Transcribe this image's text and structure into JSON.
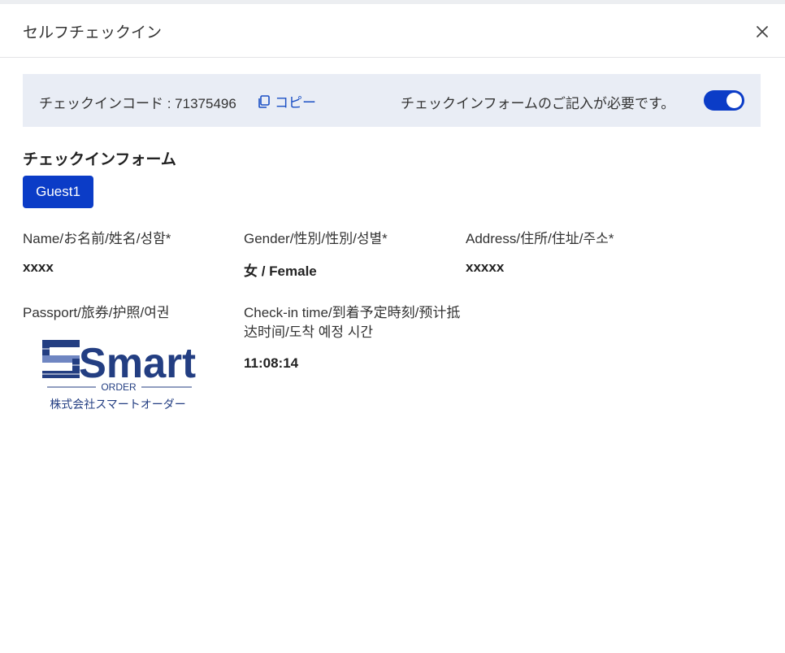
{
  "dialog": {
    "title": "セルフチェックイン",
    "close_icon": "close-icon"
  },
  "codebar": {
    "code_label": "チェックインコード : 71375496",
    "copy_label": "コピー",
    "copy_icon": "copy-icon",
    "required_label": "チェックインフォームのご記入が必要です。",
    "toggle_on": true
  },
  "form": {
    "title": "チェックインフォーム",
    "guest_tab": "Guest1",
    "fields": {
      "name": {
        "label": "Name/お名前/姓名/성함*",
        "value": "xxxx"
      },
      "gender": {
        "label": "Gender/性別/性別/성별*",
        "value": "女 / Female"
      },
      "address": {
        "label": "Address/住所/住址/주소*",
        "value": "xxxxx"
      },
      "passport": {
        "label": "Passport/旅券/护照/여권"
      },
      "checkin": {
        "label": "Check-in time/到着予定時刻/预计抵达时间/도착 예정 시간",
        "value": "11:08:14"
      }
    },
    "passport_image": {
      "brand": "Smart",
      "sub": "ORDER",
      "company": "株式会社スマートオーダー"
    }
  },
  "colors": {
    "accent": "#0b3cc7",
    "link": "#1a4fc4",
    "codebar_bg": "#e9edf5",
    "logo_navy": "#233e82"
  }
}
